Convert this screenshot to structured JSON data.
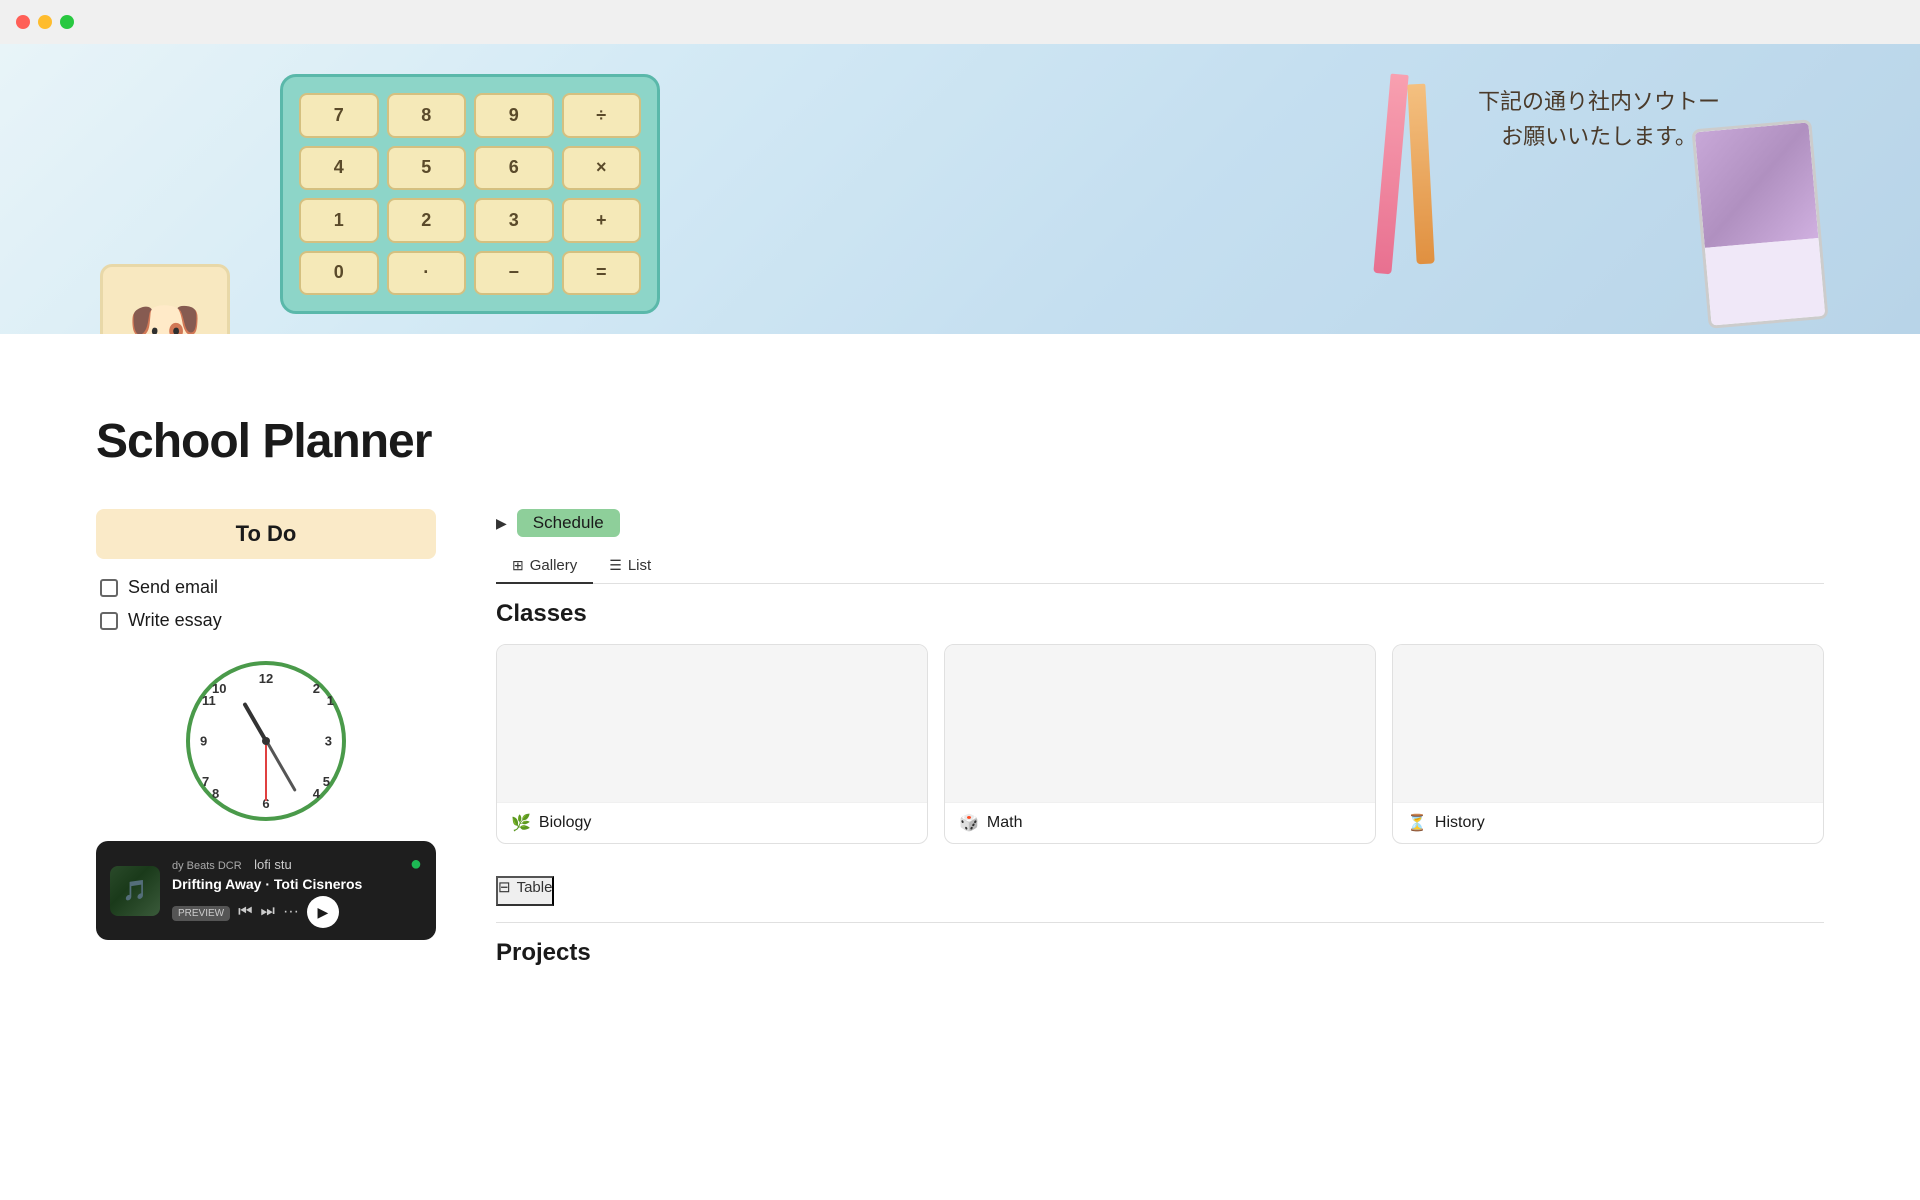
{
  "titlebar": {
    "buttons": [
      "close",
      "minimize",
      "maximize"
    ]
  },
  "hero": {
    "calc_keys": [
      "7",
      "8",
      "9",
      "÷",
      "4",
      "5",
      "6",
      "×",
      "1",
      "2",
      "3",
      "+",
      "0",
      "·",
      "−",
      "="
    ],
    "japanese_text_line1": "下記の通り社内ソウトー",
    "japanese_text_line2": "お願いいたします。"
  },
  "page": {
    "title": "School Planner"
  },
  "todo": {
    "header": "To Do",
    "items": [
      {
        "label": "Send email",
        "checked": false
      },
      {
        "label": "Write essay",
        "checked": false
      }
    ]
  },
  "music": {
    "app": "Spotify",
    "song_title": "Drifting Away",
    "artist": "Toti Cisneros",
    "playlist": "lofi stu",
    "banner_text": "dy Beats DCR",
    "preview_label": "PREVIEW"
  },
  "schedule": {
    "label": "Schedule",
    "toggle_gallery": "Gallery",
    "toggle_list": "List"
  },
  "classes": {
    "section_title": "Classes",
    "items": [
      {
        "name": "Biology",
        "icon": "🌿"
      },
      {
        "name": "Math",
        "icon": "🎲"
      },
      {
        "name": "History",
        "icon": "⏳"
      }
    ]
  },
  "projects": {
    "section_title": "Projects",
    "tab_label": "Table"
  }
}
